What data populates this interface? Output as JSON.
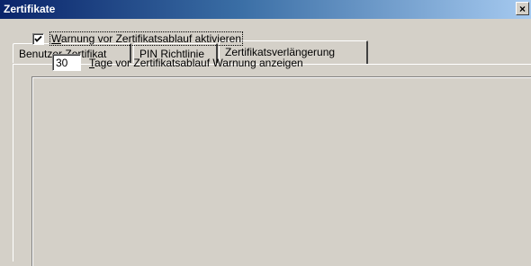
{
  "window": {
    "title": "Zertifikate",
    "close_label": "×"
  },
  "tabs": [
    {
      "label": "Benutzer Zertifikat",
      "active": false
    },
    {
      "label": "PIN Richtlinie",
      "active": false
    },
    {
      "label": "Zertifikatsverlängerung",
      "active": true
    }
  ],
  "settings": {
    "warning_checkbox": {
      "checked": true,
      "mnemonic": "W",
      "label_rest": "arnung vor Zertifikatsablauf aktivieren"
    },
    "days_field": {
      "value": "30",
      "mnemonic": "T",
      "label_rest": "age vor Zertifikatsablauf Warnung anzeigen"
    }
  }
}
